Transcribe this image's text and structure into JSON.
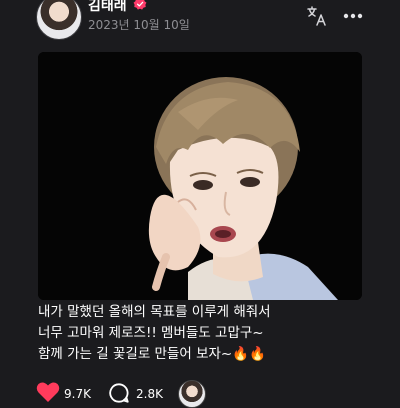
{
  "post": {
    "author": "김태래",
    "date": "2023년 10월 10일",
    "text_lines": [
      "내가 말했던 올해의 목표를 이루게 해줘서",
      "너무 고마워 제로즈!! 멤버들도 고맙구~",
      "함께 가는 길 꽃길로 만들어 보자~"
    ],
    "emoji_suffix": "🔥🔥"
  },
  "stats": {
    "likes": "9.7K",
    "comments": "2.8K"
  },
  "icons": {
    "badge": "verified-badge-icon",
    "translate": "translate-icon",
    "more": "more-dots-icon",
    "like": "heart-icon",
    "comment": "comment-bubble-icon"
  },
  "colors": {
    "background": "#1b1b1e",
    "like": "#ff3b5c",
    "badge": "#ff3b6b",
    "fire": "#ff6a00"
  }
}
